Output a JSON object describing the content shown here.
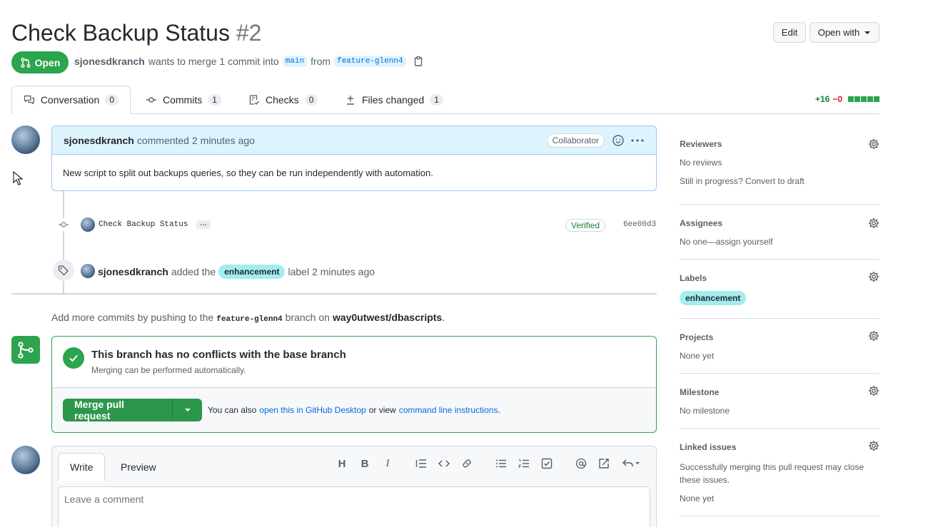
{
  "header": {
    "title": "Check Backup Status",
    "number": "#2",
    "edit_label": "Edit",
    "open_with_label": "Open with",
    "state": "Open",
    "author": "sjonesdkranch",
    "merge_text_1": "wants to merge 1 commit into",
    "base_branch": "main",
    "merge_text_2": "from",
    "head_branch": "feature-glenn4"
  },
  "tabs": [
    {
      "label": "Conversation",
      "count": "0"
    },
    {
      "label": "Commits",
      "count": "1"
    },
    {
      "label": "Checks",
      "count": "0"
    },
    {
      "label": "Files changed",
      "count": "1"
    }
  ],
  "diffstat": {
    "additions": "+16",
    "deletions": "−0"
  },
  "comment": {
    "author": "sjonesdkranch",
    "action": "commented",
    "time": "2 minutes ago",
    "role": "Collaborator",
    "body": "New script to split out backups queries, so they can be run independently with automation."
  },
  "commit": {
    "message": "Check Backup Status",
    "ellipsis": "…",
    "verified": "Verified",
    "sha": "6ee00d3"
  },
  "label_event": {
    "actor": "sjonesdkranch",
    "text_1": "added the",
    "label": "enhancement",
    "text_2": "label",
    "time": "2 minutes ago"
  },
  "push_hint": {
    "text_1": "Add more commits by pushing to the",
    "branch": "feature-glenn4",
    "text_2": "branch on",
    "repo": "way0utwest/dbascripts",
    "period": "."
  },
  "merge": {
    "title": "This branch has no conflicts with the base branch",
    "subtitle": "Merging can be performed automatically.",
    "button": "Merge pull request",
    "also_text": "You can also",
    "desktop_link": "open this in GitHub Desktop",
    "or_text": "or view",
    "cli_link": "command line instructions",
    "period": "."
  },
  "editor": {
    "write_tab": "Write",
    "preview_tab": "Preview",
    "placeholder": "Leave a comment"
  },
  "sidebar": {
    "reviewers": {
      "heading": "Reviewers",
      "value": "No reviews",
      "extra": "Still in progress? Convert to draft"
    },
    "assignees": {
      "heading": "Assignees",
      "value": "No one—assign yourself"
    },
    "labels": {
      "heading": "Labels",
      "value": "enhancement"
    },
    "projects": {
      "heading": "Projects",
      "value": "None yet"
    },
    "milestone": {
      "heading": "Milestone",
      "value": "No milestone"
    },
    "linked_issues": {
      "heading": "Linked issues",
      "value": "Successfully merging this pull request may close these issues.",
      "extra": "None yet"
    }
  },
  "colors": {
    "green": "#2da44e",
    "blue_link": "#0969da",
    "label_bg": "#a2eeef",
    "comment_header_bg": "#ddf4ff"
  }
}
